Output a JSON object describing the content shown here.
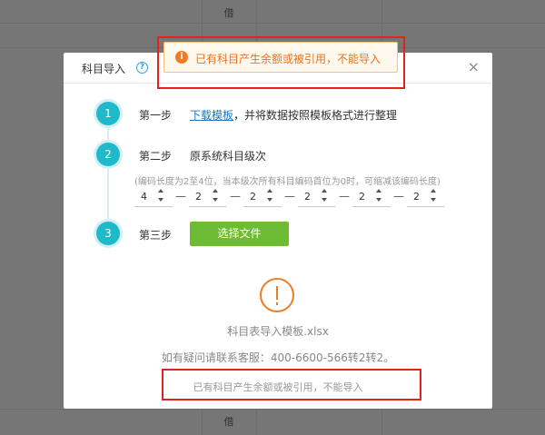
{
  "background": {
    "cell_top": "借",
    "cell_bottom": "借"
  },
  "modal": {
    "title": "科目导入",
    "help_icon": "?",
    "close_icon": "×"
  },
  "toast": {
    "icon": "i",
    "message": "已有科目产生余额或被引用，不能导入"
  },
  "steps": [
    {
      "number": "1",
      "label": "第一步"
    },
    {
      "number": "2",
      "label": "第二步"
    },
    {
      "number": "3",
      "label": "第三步"
    }
  ],
  "step1": {
    "link": "下载模板",
    "text": "，并将数据按照模板格式进行整理"
  },
  "step2": {
    "text": "原系统科目级次",
    "hint": "(编码长度为2至4位，当本级次所有科目编码首位为0时，可缩减该编码长度)",
    "levels": [
      "4",
      "2",
      "2",
      "2",
      "2",
      "2"
    ],
    "separator": "—"
  },
  "step3": {
    "button": "选择文件"
  },
  "result": {
    "file_name": "科目表导入模板.xlsx",
    "support": "如有疑问请联系客服：400-6600-566转2转2。",
    "error": "已有科目产生余额或被引用，不能导入"
  },
  "colors": {
    "accent": "#1fb9c9",
    "button": "#6ebb35",
    "warning": "#f07c22",
    "highlight": "#e3211f"
  }
}
